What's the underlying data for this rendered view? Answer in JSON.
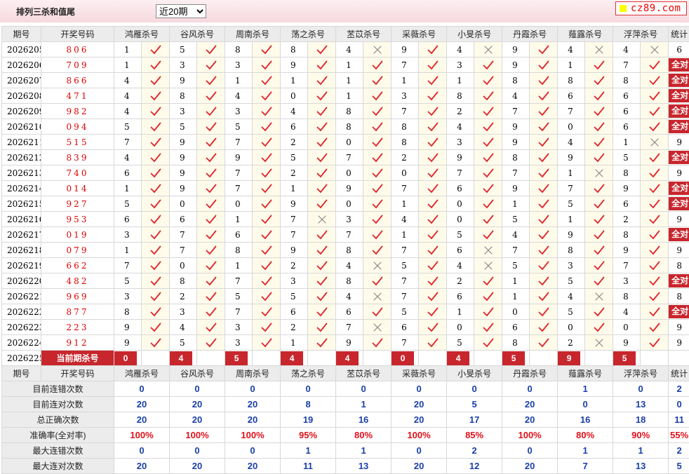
{
  "header": {
    "title": "排列三杀和值尾",
    "period_select": "近20期",
    "logo": "cz89.com"
  },
  "columns": {
    "issue": "期号",
    "draw": "开奖号码",
    "experts": [
      "鸿雁杀号",
      "谷风杀号",
      "周南杀号",
      "荡之杀号",
      "苤苡杀号",
      "采薇杀号",
      "小旻杀号",
      "丹霞杀号",
      "薤露杀号",
      "浮萍杀号"
    ],
    "stats": "统计"
  },
  "icons": {
    "correct": "check-icon",
    "wrong": "cross-icon",
    "check_color": "#e0232b",
    "cross_color": "#888888"
  },
  "rows": [
    {
      "issue": "2026205",
      "draw": "806",
      "picks": [
        1,
        5,
        8,
        8,
        4,
        9,
        4,
        9,
        4,
        4
      ],
      "marks": [
        1,
        1,
        1,
        1,
        0,
        1,
        0,
        1,
        0,
        0
      ],
      "stat": "6",
      "all": false
    },
    {
      "issue": "2026206",
      "draw": "709",
      "picks": [
        1,
        3,
        3,
        9,
        1,
        7,
        3,
        9,
        1,
        7
      ],
      "marks": [
        1,
        1,
        1,
        1,
        1,
        1,
        1,
        1,
        1,
        1
      ],
      "stat": "全对",
      "all": true
    },
    {
      "issue": "2026207",
      "draw": "866",
      "picks": [
        4,
        9,
        1,
        1,
        1,
        1,
        1,
        8,
        8,
        8
      ],
      "marks": [
        1,
        1,
        1,
        1,
        1,
        1,
        1,
        1,
        1,
        1
      ],
      "stat": "全对",
      "all": true
    },
    {
      "issue": "2026208",
      "draw": "471",
      "picks": [
        4,
        8,
        4,
        0,
        1,
        3,
        8,
        4,
        6,
        6
      ],
      "marks": [
        1,
        1,
        1,
        1,
        1,
        1,
        1,
        1,
        1,
        1
      ],
      "stat": "全对",
      "all": true
    },
    {
      "issue": "2026209",
      "draw": "982",
      "picks": [
        4,
        3,
        3,
        4,
        8,
        7,
        2,
        7,
        7,
        6
      ],
      "marks": [
        1,
        1,
        1,
        1,
        1,
        1,
        1,
        1,
        1,
        1
      ],
      "stat": "全对",
      "all": true
    },
    {
      "issue": "2026210",
      "draw": "094",
      "picks": [
        5,
        5,
        5,
        6,
        8,
        8,
        4,
        9,
        0,
        6
      ],
      "marks": [
        1,
        1,
        1,
        1,
        1,
        1,
        1,
        1,
        1,
        1
      ],
      "stat": "全对",
      "all": true
    },
    {
      "issue": "2026211",
      "draw": "515",
      "picks": [
        7,
        9,
        7,
        2,
        0,
        8,
        3,
        9,
        4,
        1
      ],
      "marks": [
        1,
        1,
        1,
        1,
        1,
        1,
        1,
        1,
        1,
        0
      ],
      "stat": "9",
      "all": false
    },
    {
      "issue": "2026212",
      "draw": "839",
      "picks": [
        4,
        9,
        9,
        5,
        7,
        2,
        9,
        8,
        9,
        5
      ],
      "marks": [
        1,
        1,
        1,
        1,
        1,
        1,
        1,
        1,
        1,
        1
      ],
      "stat": "全对",
      "all": true
    },
    {
      "issue": "2026213",
      "draw": "740",
      "picks": [
        6,
        9,
        7,
        2,
        0,
        0,
        7,
        7,
        1,
        8
      ],
      "marks": [
        1,
        1,
        1,
        1,
        1,
        1,
        1,
        1,
        0,
        1
      ],
      "stat": "9",
      "all": false
    },
    {
      "issue": "2026214",
      "draw": "014",
      "picks": [
        1,
        9,
        7,
        1,
        9,
        7,
        6,
        9,
        7,
        9
      ],
      "marks": [
        1,
        1,
        1,
        1,
        1,
        1,
        1,
        1,
        1,
        1
      ],
      "stat": "全对",
      "all": true
    },
    {
      "issue": "2026215",
      "draw": "927",
      "picks": [
        5,
        0,
        0,
        9,
        0,
        1,
        0,
        1,
        5,
        6
      ],
      "marks": [
        1,
        1,
        1,
        1,
        1,
        1,
        1,
        1,
        1,
        1
      ],
      "stat": "全对",
      "all": true
    },
    {
      "issue": "2026216",
      "draw": "953",
      "picks": [
        6,
        6,
        1,
        7,
        3,
        4,
        0,
        5,
        1,
        2
      ],
      "marks": [
        1,
        1,
        1,
        0,
        1,
        1,
        1,
        1,
        1,
        1
      ],
      "stat": "9",
      "all": false
    },
    {
      "issue": "2026217",
      "draw": "019",
      "picks": [
        3,
        7,
        6,
        7,
        7,
        1,
        5,
        4,
        9,
        8
      ],
      "marks": [
        1,
        1,
        1,
        1,
        1,
        1,
        1,
        1,
        1,
        1
      ],
      "stat": "全对",
      "all": true
    },
    {
      "issue": "2026218",
      "draw": "079",
      "picks": [
        1,
        7,
        8,
        9,
        8,
        7,
        6,
        7,
        8,
        9
      ],
      "marks": [
        1,
        1,
        1,
        1,
        1,
        1,
        0,
        1,
        1,
        1
      ],
      "stat": "9",
      "all": false
    },
    {
      "issue": "2026219",
      "draw": "662",
      "picks": [
        7,
        0,
        1,
        2,
        4,
        5,
        4,
        5,
        3,
        7
      ],
      "marks": [
        1,
        1,
        1,
        1,
        0,
        1,
        0,
        1,
        1,
        1
      ],
      "stat": "8",
      "all": false
    },
    {
      "issue": "2026220",
      "draw": "482",
      "picks": [
        5,
        8,
        7,
        3,
        8,
        7,
        2,
        1,
        5,
        3
      ],
      "marks": [
        1,
        1,
        1,
        1,
        1,
        1,
        1,
        1,
        1,
        1
      ],
      "stat": "全对",
      "all": true
    },
    {
      "issue": "2026221",
      "draw": "969",
      "picks": [
        3,
        2,
        5,
        5,
        4,
        7,
        6,
        1,
        4,
        8
      ],
      "marks": [
        1,
        1,
        1,
        1,
        0,
        1,
        1,
        1,
        0,
        1
      ],
      "stat": "8",
      "all": false
    },
    {
      "issue": "2026222",
      "draw": "877",
      "picks": [
        8,
        3,
        7,
        6,
        6,
        5,
        1,
        0,
        5,
        4
      ],
      "marks": [
        1,
        1,
        1,
        1,
        1,
        1,
        1,
        1,
        1,
        1
      ],
      "stat": "全对",
      "all": true
    },
    {
      "issue": "2026223",
      "draw": "223",
      "picks": [
        9,
        4,
        3,
        2,
        7,
        6,
        0,
        6,
        0,
        0
      ],
      "marks": [
        1,
        1,
        1,
        1,
        0,
        1,
        1,
        1,
        1,
        1
      ],
      "stat": "9",
      "all": false
    },
    {
      "issue": "2026224",
      "draw": "912",
      "picks": [
        9,
        5,
        3,
        1,
        9,
        7,
        5,
        8,
        2,
        9
      ],
      "marks": [
        1,
        1,
        1,
        1,
        1,
        1,
        1,
        1,
        0,
        1
      ],
      "stat": "9",
      "all": false
    }
  ],
  "current": {
    "issue": "2026225",
    "label": "当前期杀号",
    "picks": [
      "0",
      "4",
      "5",
      "4",
      "4",
      "0",
      "4",
      "5",
      "9",
      "5"
    ]
  },
  "summary": [
    {
      "label": "目前连错次数",
      "values": [
        "0",
        "0",
        "0",
        "0",
        "0",
        "0",
        "0",
        "0",
        "1",
        "0",
        "2"
      ],
      "rate": false
    },
    {
      "label": "目前连对次数",
      "values": [
        "20",
        "20",
        "20",
        "8",
        "1",
        "20",
        "5",
        "20",
        "0",
        "13",
        "0"
      ],
      "rate": false
    },
    {
      "label": "总正确次数",
      "values": [
        "20",
        "20",
        "20",
        "19",
        "16",
        "20",
        "17",
        "20",
        "16",
        "18",
        "11"
      ],
      "rate": false
    },
    {
      "label": "准确率(全对率)",
      "values": [
        "100%",
        "100%",
        "100%",
        "95%",
        "80%",
        "100%",
        "85%",
        "100%",
        "80%",
        "90%",
        "55%"
      ],
      "rate": true
    },
    {
      "label": "最大连错次数",
      "values": [
        "0",
        "0",
        "0",
        "1",
        "1",
        "0",
        "2",
        "0",
        "1",
        "1",
        "2"
      ],
      "rate": false
    },
    {
      "label": "最大连对次数",
      "values": [
        "20",
        "20",
        "20",
        "11",
        "13",
        "20",
        "12",
        "20",
        "7",
        "13",
        "5"
      ],
      "rate": false
    }
  ]
}
